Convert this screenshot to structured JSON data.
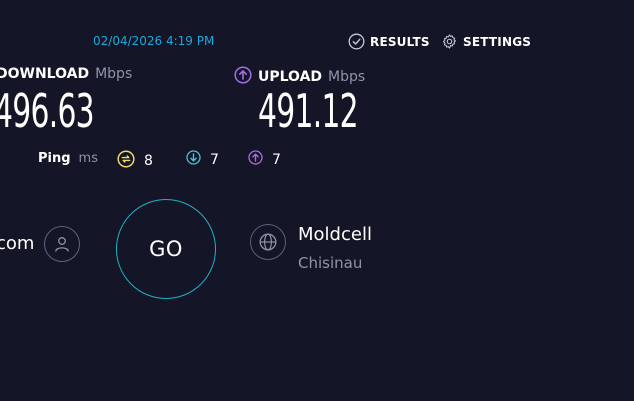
{
  "header": {
    "timestamp": "02/04/2026 4:19 PM",
    "results_label": "RESULTS",
    "settings_label": "SETTINGS"
  },
  "download": {
    "label": "DOWNLOAD",
    "unit": "Mbps",
    "value": "496.63"
  },
  "upload": {
    "label": "UPLOAD",
    "unit": "Mbps",
    "value": "491.12"
  },
  "ping": {
    "label": "Ping",
    "unit": "ms",
    "idle": "8",
    "download": "7",
    "upload": "7"
  },
  "host": {
    "text": "com"
  },
  "go_button": {
    "label": "GO"
  },
  "server": {
    "name": "Moldcell",
    "location": "Chisinau"
  },
  "colors": {
    "background": "#141526",
    "timestamp": "#1ca8dd",
    "go_ring": "#1fb2c6",
    "download_accent": "#45c4d6",
    "upload_accent": "#a76ee8",
    "ping_accent": "#f0d968"
  },
  "icons": {
    "results": "check-circle-icon",
    "settings": "gear-icon",
    "upload": "arrow-up-circle-icon",
    "ping": "idle-latency-icon",
    "ping_download": "arrow-down-circle-icon",
    "ping_upload": "arrow-up-circle-icon",
    "user": "user-icon",
    "server": "globe-icon"
  }
}
